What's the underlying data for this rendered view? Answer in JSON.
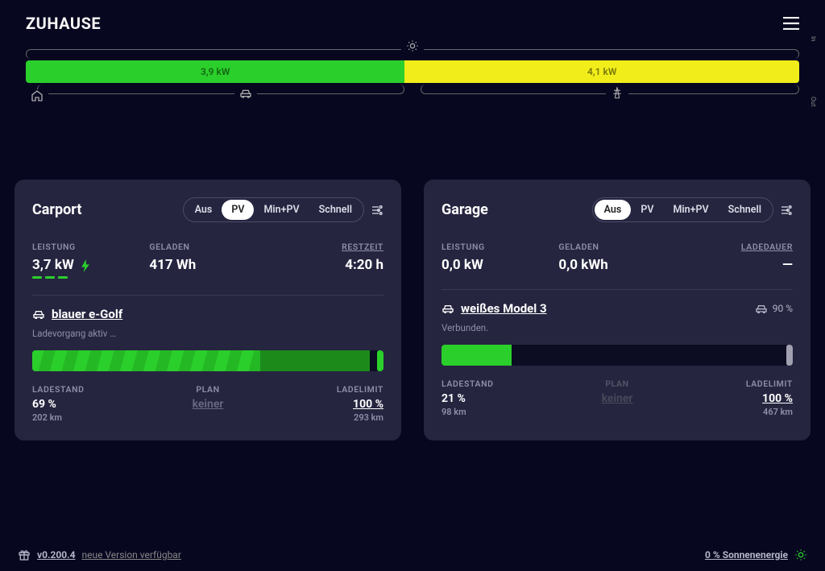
{
  "header": {
    "title": "ZUHAUSE"
  },
  "energy_bar": {
    "in_label": "In",
    "out_label": "Out",
    "segments": {
      "green": {
        "width_pct": 49,
        "label": "3,9 kW"
      },
      "yellow": {
        "width_pct": 51,
        "label": "4,1 kW"
      }
    }
  },
  "modes": [
    "Aus",
    "PV",
    "Min+PV",
    "Schnell"
  ],
  "loadpoints": [
    {
      "title": "Carport",
      "active_mode": "PV",
      "stats": {
        "leistung_label": "LEISTUNG",
        "leistung": "3,7 kW",
        "leistung_icon": true,
        "geladen_label": "GELADEN",
        "geladen": "417 Wh",
        "time_label": "RESTZEIT",
        "time": "4:20 h"
      },
      "vehicle": {
        "name": "blauer e-Golf",
        "status": "Ladevorgang aktiv …",
        "show_soc_icon": false,
        "soc_text": ""
      },
      "progress": {
        "fill_pct": 65,
        "striped": true,
        "second_pct": 96,
        "limit_color": "green"
      },
      "triple": {
        "ladestand_label": "LADESTAND",
        "ladestand": "69 %",
        "ladestand_sub": "202 km",
        "plan_label": "PLAN",
        "plan_val": "keiner",
        "plan_disabled": false,
        "limit_label": "LADELIMIT",
        "limit": "100 %",
        "limit_sub": "293 km"
      }
    },
    {
      "title": "Garage",
      "active_mode": "Aus",
      "stats": {
        "leistung_label": "LEISTUNG",
        "leistung": "0,0 kW",
        "leistung_icon": false,
        "geladen_label": "GELADEN",
        "geladen": "0,0 kWh",
        "time_label": "LADEDAUER",
        "time": "—"
      },
      "vehicle": {
        "name": "weißes Model 3",
        "status": "Verbunden.",
        "show_soc_icon": true,
        "soc_text": "90 %"
      },
      "progress": {
        "fill_pct": 20,
        "striped": false,
        "second_pct": 0,
        "limit_color": "gray"
      },
      "triple": {
        "ladestand_label": "LADESTAND",
        "ladestand": "21 %",
        "ladestand_sub": "98 km",
        "plan_label": "PLAN",
        "plan_val": "keiner",
        "plan_disabled": true,
        "limit_label": "LADELIMIT",
        "limit": "100 %",
        "limit_sub": "467 km"
      }
    }
  ],
  "footer": {
    "version": "v0.200.4",
    "update_text": "neue Version verfügbar",
    "solar_text": "0 % Sonnenenergie"
  }
}
